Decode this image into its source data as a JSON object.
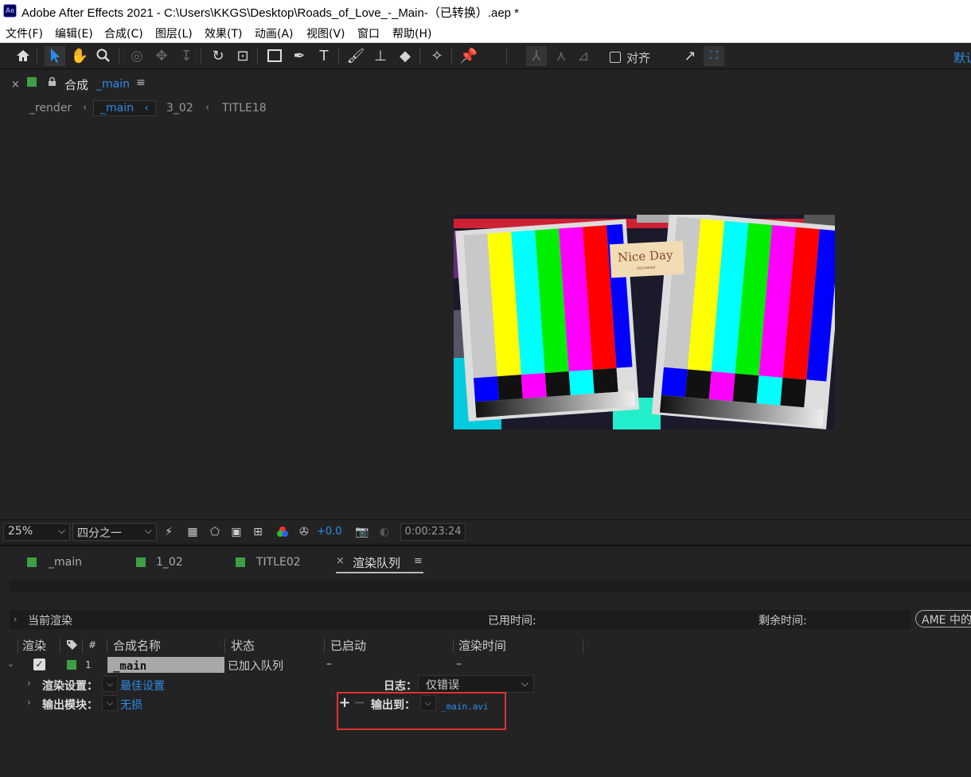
{
  "window": {
    "app_icon": "Ae",
    "title": "Adobe After Effects 2021 - C:\\Users\\KKGS\\Desktop\\Roads_of_Love_-_Main-（已转换）.aep *"
  },
  "menu": [
    "文件(F)",
    "编辑(E)",
    "合成(C)",
    "图层(L)",
    "效果(T)",
    "动画(A)",
    "视图(V)",
    "窗口",
    "帮助(H)"
  ],
  "toolbar": {
    "tools": [
      "home-icon",
      "selection-tool-icon",
      "hand-tool-icon",
      "zoom-tool-icon",
      "orbit-camera-icon",
      "pan-camera-icon",
      "dolly-camera-icon",
      "rotate-tool-icon",
      "pan-behind-tool-icon",
      "rectangle-tool-icon",
      "pen-tool-icon",
      "type-tool-icon",
      "brush-tool-icon",
      "clone-stamp-icon",
      "eraser-tool-icon",
      "roto-brush-icon",
      "puppet-pin-icon"
    ],
    "snap_label": "对齐",
    "workspace": "默认"
  },
  "composition": {
    "panel_label": "合成",
    "name": "_main",
    "breadcrumbs": [
      "_render",
      "_main",
      "3_02",
      "TITLE18"
    ],
    "active_breadcrumb": "_main",
    "preview": {
      "title": "Nice Day",
      "subtitle": "2021/08/08"
    },
    "footer": {
      "zoom": "25%",
      "resolution": "四分之一",
      "exposure": "+0.0",
      "timecode": "0:00:23:24"
    }
  },
  "bottom_tabs": [
    "_main",
    "1_02",
    "TITLE02",
    "渲染队列"
  ],
  "render_queue": {
    "current_render_label": "当前渲染",
    "elapsed_label": "已用时间:",
    "remaining_label": "剩余时间:",
    "ame_button": "AME 中的",
    "columns": [
      "渲染",
      "#",
      "合成名称",
      "状态",
      "已启动",
      "渲染时间"
    ],
    "item": {
      "index": "1",
      "comp_name": "_main",
      "status": "已加入队列",
      "started": "–",
      "render_time": "–"
    },
    "render_settings_label": "渲染设置：",
    "render_settings_value": "最佳设置",
    "log_label": "日志：",
    "log_value": "仅错误",
    "output_module_label": "输出模块：",
    "output_module_value": "无损",
    "output_to_label": "输出到：",
    "output_path": "_main.avi"
  },
  "colors": {
    "accent": "#2d8ceb",
    "label_green": "#3da046",
    "highlight_red": "#e23232",
    "panel": "#232323"
  }
}
